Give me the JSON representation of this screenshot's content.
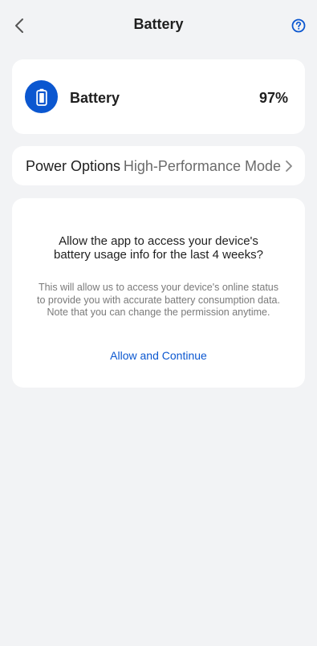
{
  "header": {
    "title": "Battery",
    "back_icon": "chevron-left-icon",
    "help_icon": "help-circle-icon"
  },
  "battery": {
    "label": "Battery",
    "percent": "97%",
    "icon": "battery-icon"
  },
  "power_options": {
    "label": "Power Options",
    "value": "High-Performance Mode",
    "icon": "chevron-right-icon"
  },
  "permission": {
    "title": "Allow the app to access your device's battery usage info for the last 4 weeks?",
    "description": "This will allow us to access your device's online status to provide you with accurate battery consumption data. Note that you can change the permission anytime.",
    "action": "Allow and Continue"
  },
  "colors": {
    "accent": "#0b57d0",
    "background": "#f2f3f5",
    "card": "#ffffff"
  }
}
